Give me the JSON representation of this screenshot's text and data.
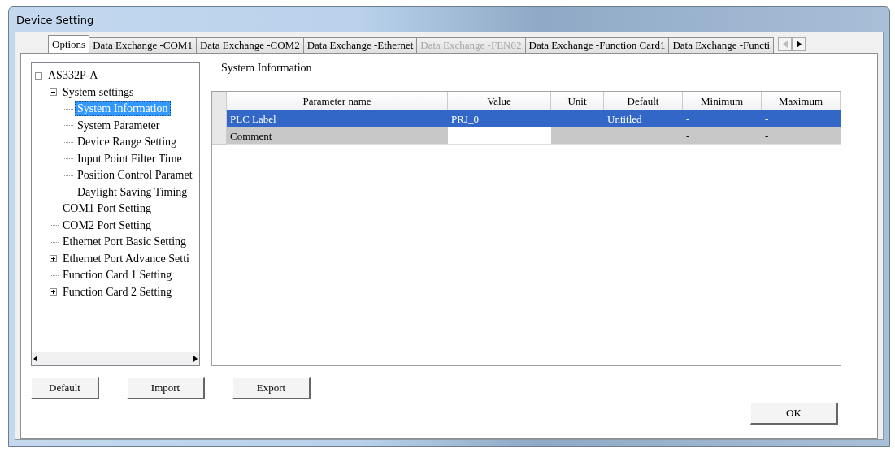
{
  "window": {
    "title": "Device Setting"
  },
  "tabs": [
    {
      "label": "Options",
      "selected": true,
      "disabled": false
    },
    {
      "label": "Data Exchange -COM1",
      "selected": false,
      "disabled": false
    },
    {
      "label": "Data Exchange -COM2",
      "selected": false,
      "disabled": false
    },
    {
      "label": "Data Exchange -Ethernet",
      "selected": false,
      "disabled": false
    },
    {
      "label": "Data Exchange -FEN02",
      "selected": false,
      "disabled": true
    },
    {
      "label": "Data Exchange -Function Card1",
      "selected": false,
      "disabled": false
    },
    {
      "label": "Data Exchange -Functi",
      "selected": false,
      "disabled": false
    }
  ],
  "tree": [
    {
      "label": "AS332P-A",
      "expanded": true,
      "selected": false,
      "children": [
        {
          "label": "System settings",
          "expanded": true,
          "selected": false,
          "children": [
            {
              "label": "System Information",
              "selected": true
            },
            {
              "label": "System Parameter",
              "selected": false
            },
            {
              "label": "Device Range Setting",
              "selected": false
            },
            {
              "label": "Input Point Filter Time",
              "selected": false
            },
            {
              "label": "Position Control Paramet",
              "selected": false
            },
            {
              "label": "Daylight Saving Timing",
              "selected": false
            }
          ]
        },
        {
          "label": "COM1 Port Setting",
          "selected": false
        },
        {
          "label": "COM2 Port Setting",
          "selected": false
        },
        {
          "label": "Ethernet Port Basic Setting",
          "selected": false
        },
        {
          "label": "Ethernet Port Advance Setti",
          "expanded": false,
          "selected": false
        },
        {
          "label": "Function Card 1 Setting",
          "selected": false
        },
        {
          "label": "Function Card 2 Setting",
          "expanded": false,
          "selected": false
        }
      ]
    }
  ],
  "section_title": "System Information",
  "table": {
    "columns": [
      "Parameter name",
      "Value",
      "Unit",
      "Default",
      "Minimum",
      "Maximum"
    ],
    "rows": [
      {
        "selected": true,
        "cells": [
          "PLC Label",
          "PRJ_0",
          "",
          "Untitled",
          "-",
          "-"
        ]
      },
      {
        "selected": false,
        "cells": [
          "Comment",
          "",
          "",
          "",
          "-",
          "-"
        ]
      }
    ]
  },
  "buttons": [
    "Default",
    "Import",
    "Export"
  ],
  "ok_button": "OK"
}
